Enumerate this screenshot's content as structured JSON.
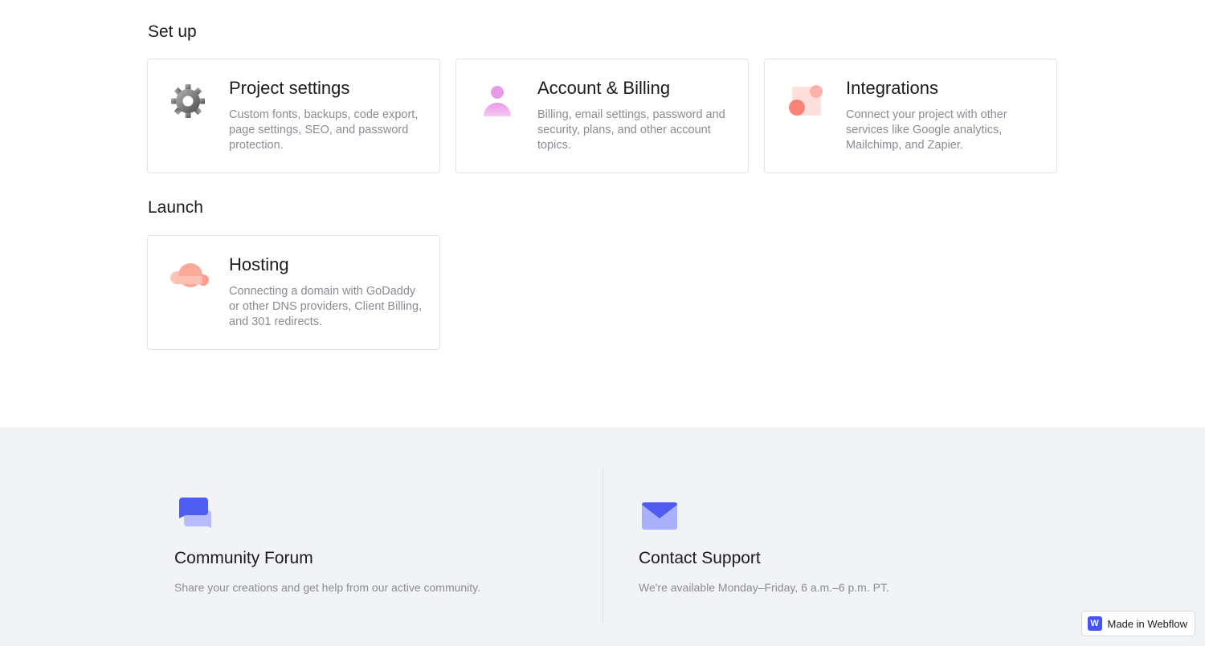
{
  "sections": {
    "setup_title": "Set up",
    "launch_title": "Launch"
  },
  "cards": [
    {
      "title": "Project settings",
      "description": "Custom fonts, backups, code export, page settings, SEO, and password protection.",
      "icon": "gear-icon"
    },
    {
      "title": "Account & Billing",
      "description": "Billing, email settings, password and security, plans, and other account topics.",
      "icon": "person-icon"
    },
    {
      "title": "Integrations",
      "description": "Connect your project with other services like Google analytics, Mailchimp, and Zapier.",
      "icon": "integrations-icon"
    },
    {
      "title": "Hosting",
      "description": "Connecting a domain with GoDaddy or other DNS providers, Client Billing, and 301 redirects.",
      "icon": "cloud-icon"
    }
  ],
  "footer": {
    "forum": {
      "title": "Community Forum",
      "description": "Share your creations and get help from our active community.",
      "icon": "chat-bubbles-icon"
    },
    "support": {
      "title": "Contact Support",
      "description": "We're available Monday–Friday, 6 a.m.–6 p.m. PT.",
      "icon": "envelope-icon"
    }
  },
  "badge": {
    "logo_letter": "W",
    "label": "Made in Webflow"
  },
  "colors": {
    "accent": "#4353ff",
    "card_border": "#e2e3e6",
    "footer_bg": "#f2f3f5"
  }
}
